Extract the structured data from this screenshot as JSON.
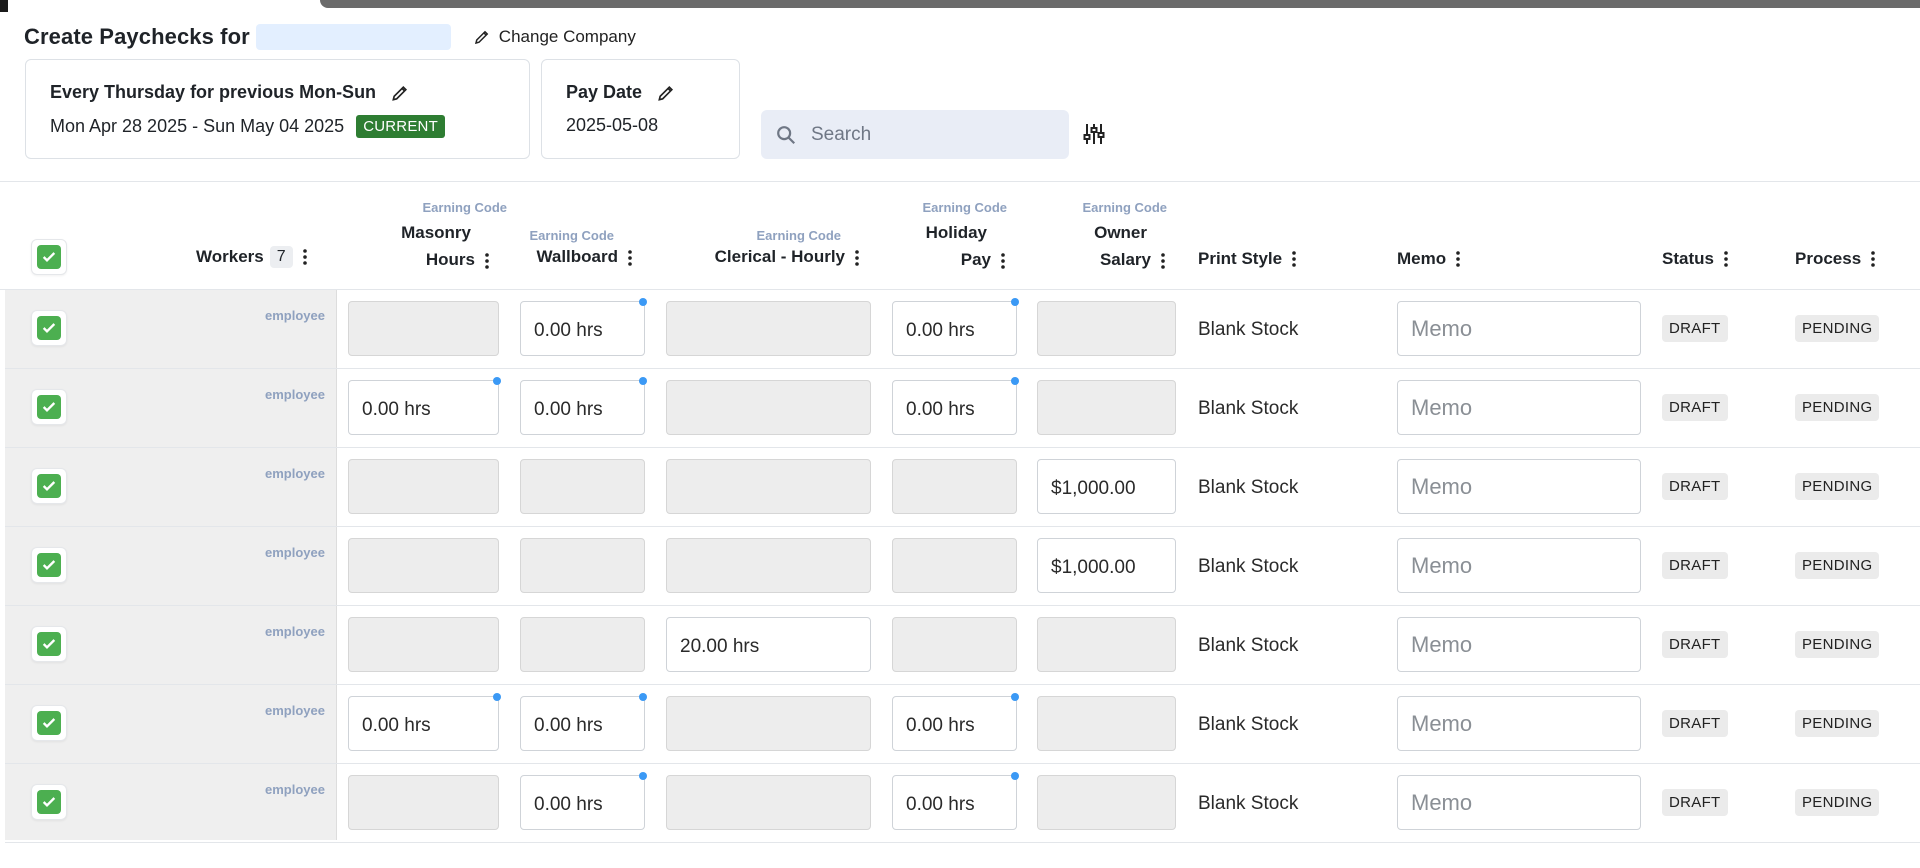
{
  "header": {
    "title": "Create Paychecks for",
    "change_company": "Change Company"
  },
  "pay_period": {
    "title": "Every Thursday for previous Mon-Sun",
    "range": "Mon Apr 28 2025 - Sun May 04 2025",
    "badge": "CURRENT"
  },
  "pay_date": {
    "title": "Pay Date",
    "value": "2025-05-08"
  },
  "search": {
    "placeholder": "Search"
  },
  "columns": {
    "workers": "Workers",
    "workers_count": "7",
    "earning_code_label": "Earning Code",
    "masonry_1": "Masonry",
    "masonry_2": "Hours",
    "wallboard": "Wallboard",
    "clerical": "Clerical - Hourly",
    "holiday_1": "Holiday",
    "holiday_2": "Pay",
    "owner_1": "Owner",
    "owner_2": "Salary",
    "print_style": "Print Style",
    "memo": "Memo",
    "status": "Status",
    "process": "Process"
  },
  "rows": [
    {
      "type": "employee",
      "masonry": "",
      "wallboard": "0.00 hrs",
      "clerical": "",
      "holiday": "0.00 hrs",
      "owner": "",
      "print_style": "Blank Stock",
      "memo_placeholder": "Memo",
      "status": "DRAFT",
      "process": "PENDING"
    },
    {
      "type": "employee",
      "masonry": "0.00 hrs",
      "wallboard": "0.00 hrs",
      "clerical": "",
      "holiday": "0.00 hrs",
      "owner": "",
      "print_style": "Blank Stock",
      "memo_placeholder": "Memo",
      "status": "DRAFT",
      "process": "PENDING"
    },
    {
      "type": "employee",
      "masonry": "",
      "wallboard": "",
      "clerical": "",
      "holiday": "",
      "owner": "$1,000.00",
      "print_style": "Blank Stock",
      "memo_placeholder": "Memo",
      "status": "DRAFT",
      "process": "PENDING"
    },
    {
      "type": "employee",
      "masonry": "",
      "wallboard": "",
      "clerical": "",
      "holiday": "",
      "owner": "$1,000.00",
      "print_style": "Blank Stock",
      "memo_placeholder": "Memo",
      "status": "DRAFT",
      "process": "PENDING"
    },
    {
      "type": "employee",
      "masonry": "",
      "wallboard": "",
      "clerical": "20.00 hrs",
      "holiday": "",
      "owner": "",
      "print_style": "Blank Stock",
      "memo_placeholder": "Memo",
      "status": "DRAFT",
      "process": "PENDING"
    },
    {
      "type": "employee",
      "masonry": "0.00 hrs",
      "wallboard": "0.00 hrs",
      "clerical": "",
      "holiday": "0.00 hrs",
      "owner": "",
      "print_style": "Blank Stock",
      "memo_placeholder": "Memo",
      "status": "DRAFT",
      "process": "PENDING"
    },
    {
      "type": "employee",
      "masonry": "",
      "wallboard": "0.00 hrs",
      "clerical": "",
      "holiday": "0.00 hrs",
      "owner": "",
      "print_style": "Blank Stock",
      "memo_placeholder": "Memo",
      "status": "DRAFT",
      "process": "PENDING"
    }
  ],
  "colors": {
    "accent_green": "#4caf50",
    "badge_green": "#2e7d32",
    "earning_code_blue": "#8fa1bf",
    "modified_dot": "#3b99f5"
  }
}
